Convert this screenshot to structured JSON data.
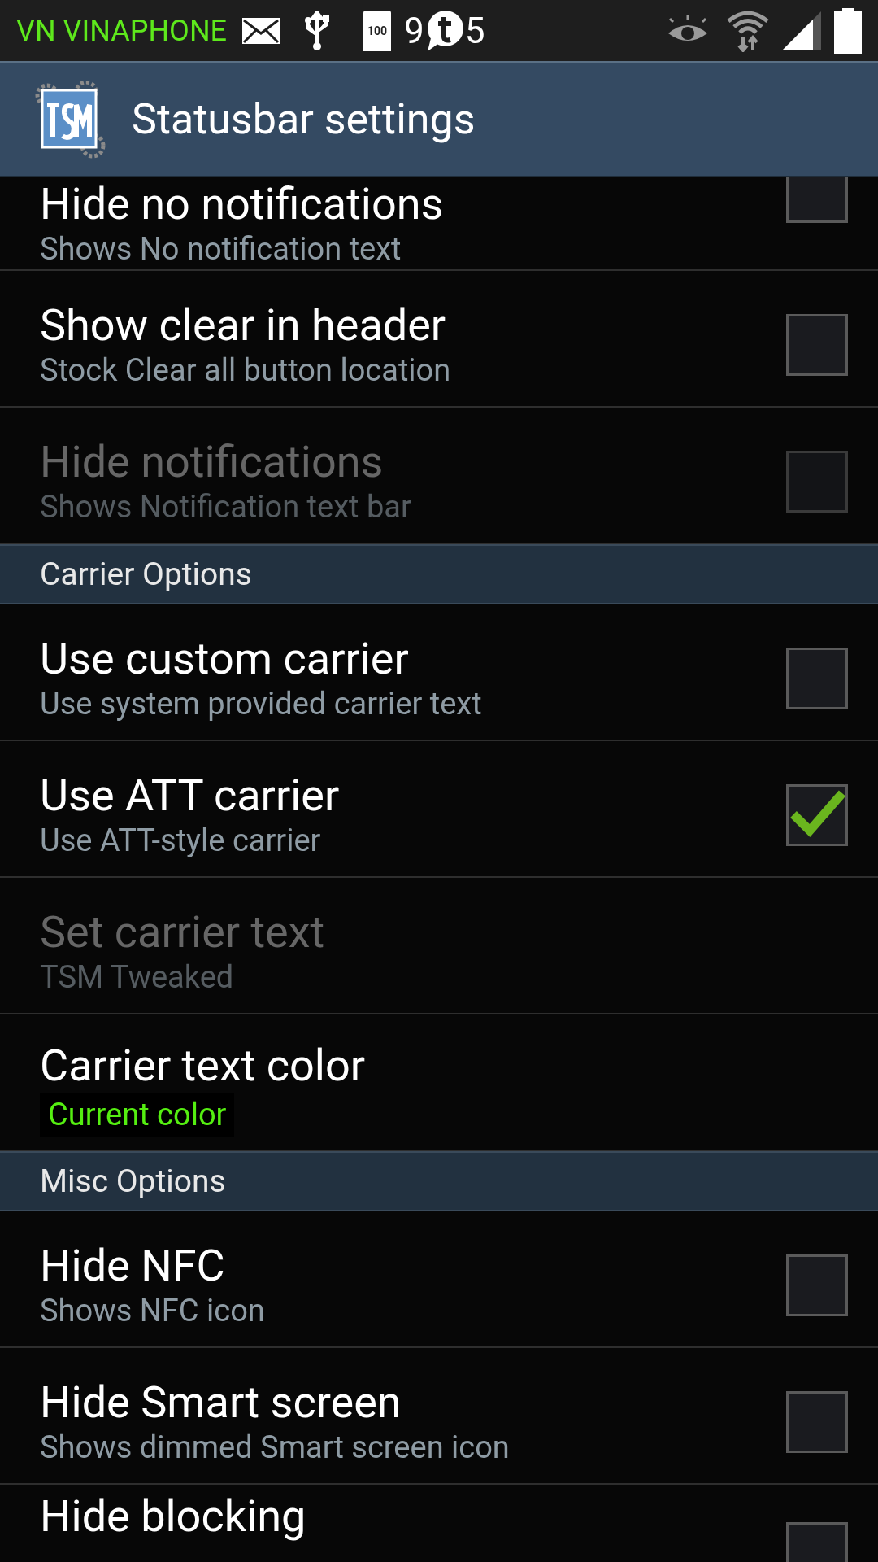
{
  "status_bar": {
    "carrier": "VN VINAPHONE",
    "time_parts": [
      "9",
      "5"
    ],
    "storage_label": "100"
  },
  "header": {
    "title": "Statusbar settings"
  },
  "sections": [
    {
      "rows": [
        {
          "kind": "checkbox",
          "title": "Hide no notifications",
          "summary": "Shows No notification text",
          "checked": false,
          "disabled": false
        },
        {
          "kind": "checkbox",
          "title": "Show clear in header",
          "summary": "Stock Clear all button location",
          "checked": false,
          "disabled": false
        },
        {
          "kind": "checkbox",
          "title": "Hide notifications",
          "summary": "Shows Notification text bar",
          "checked": false,
          "disabled": true
        }
      ]
    },
    {
      "title": "Carrier Options",
      "rows": [
        {
          "kind": "checkbox",
          "title": "Use custom carrier",
          "summary": "Use system provided carrier text",
          "checked": false,
          "disabled": false
        },
        {
          "kind": "checkbox",
          "title": "Use ATT carrier",
          "summary": "Use ATT-style carrier",
          "checked": true,
          "disabled": false
        },
        {
          "kind": "text",
          "title": "Set carrier text",
          "summary": "TSM Tweaked",
          "disabled": true
        },
        {
          "kind": "color",
          "title": "Carrier text color",
          "summary": "Current color",
          "color": "#55ee11",
          "disabled": false
        }
      ]
    },
    {
      "title": "Misc Options",
      "rows": [
        {
          "kind": "checkbox",
          "title": "Hide NFC",
          "summary": "Shows NFC icon",
          "checked": false,
          "disabled": false
        },
        {
          "kind": "checkbox",
          "title": "Hide Smart screen",
          "summary": "Shows dimmed Smart screen icon",
          "checked": false,
          "disabled": false
        },
        {
          "kind": "checkbox",
          "title": "Hide blocking",
          "checked": false,
          "disabled": false
        }
      ]
    }
  ]
}
